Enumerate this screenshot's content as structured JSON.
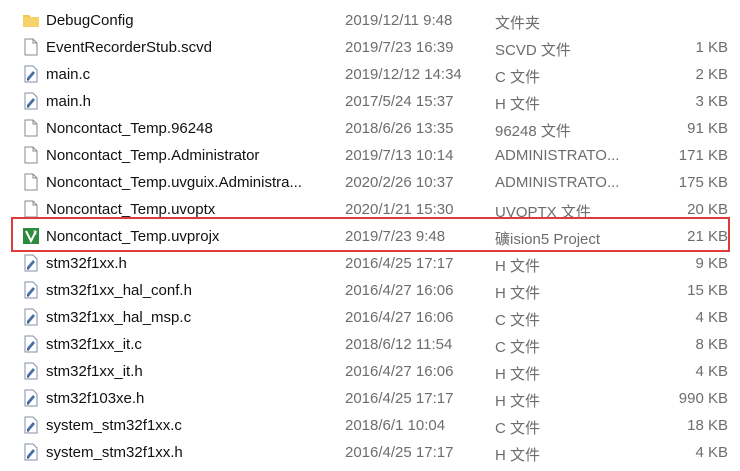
{
  "files": [
    {
      "name": "DebugConfig",
      "date": "2019/12/11 9:48",
      "type": "文件夹",
      "size": "",
      "icon": "folder-icon"
    },
    {
      "name": "EventRecorderStub.scvd",
      "date": "2019/7/23 16:39",
      "type": "SCVD 文件",
      "size": "1 KB",
      "icon": "file-icon"
    },
    {
      "name": "main.c",
      "date": "2019/12/12 14:34",
      "type": "C 文件",
      "size": "2 KB",
      "icon": "source-file-icon"
    },
    {
      "name": "main.h",
      "date": "2017/5/24 15:37",
      "type": "H 文件",
      "size": "3 KB",
      "icon": "source-file-icon"
    },
    {
      "name": "Noncontact_Temp.96248",
      "date": "2018/6/26 13:35",
      "type": "96248 文件",
      "size": "91 KB",
      "icon": "file-icon"
    },
    {
      "name": "Noncontact_Temp.Administrator",
      "date": "2019/7/13 10:14",
      "type": "ADMINISTRATO...",
      "size": "171 KB",
      "icon": "file-icon"
    },
    {
      "name": "Noncontact_Temp.uvguix.Administra...",
      "date": "2020/2/26 10:37",
      "type": "ADMINISTRATO...",
      "size": "175 KB",
      "icon": "file-icon"
    },
    {
      "name": "Noncontact_Temp.uvoptx",
      "date": "2020/1/21 15:30",
      "type": "UVOPTX 文件",
      "size": "20 KB",
      "icon": "file-icon"
    },
    {
      "name": "Noncontact_Temp.uvprojx",
      "date": "2019/7/23 9:48",
      "type": "礦ision5 Project",
      "size": "21 KB",
      "icon": "uvision-project-icon"
    },
    {
      "name": "stm32f1xx.h",
      "date": "2016/4/25 17:17",
      "type": "H 文件",
      "size": "9 KB",
      "icon": "source-file-icon"
    },
    {
      "name": "stm32f1xx_hal_conf.h",
      "date": "2016/4/27 16:06",
      "type": "H 文件",
      "size": "15 KB",
      "icon": "source-file-icon"
    },
    {
      "name": "stm32f1xx_hal_msp.c",
      "date": "2016/4/27 16:06",
      "type": "C 文件",
      "size": "4 KB",
      "icon": "source-file-icon"
    },
    {
      "name": "stm32f1xx_it.c",
      "date": "2018/6/12 11:54",
      "type": "C 文件",
      "size": "8 KB",
      "icon": "source-file-icon"
    },
    {
      "name": "stm32f1xx_it.h",
      "date": "2016/4/27 16:06",
      "type": "H 文件",
      "size": "4 KB",
      "icon": "source-file-icon"
    },
    {
      "name": "stm32f103xe.h",
      "date": "2016/4/25 17:17",
      "type": "H 文件",
      "size": "990 KB",
      "icon": "source-file-icon"
    },
    {
      "name": "system_stm32f1xx.c",
      "date": "2018/6/1 10:04",
      "type": "C 文件",
      "size": "18 KB",
      "icon": "source-file-icon"
    },
    {
      "name": "system_stm32f1xx.h",
      "date": "2016/4/25 17:17",
      "type": "H 文件",
      "size": "4 KB",
      "icon": "source-file-icon"
    }
  ],
  "highlighted_row": 8,
  "colors": {
    "highlight_border": "#e03b3b",
    "folder": "#f2c14e",
    "uvision": "#2e8b3d"
  }
}
